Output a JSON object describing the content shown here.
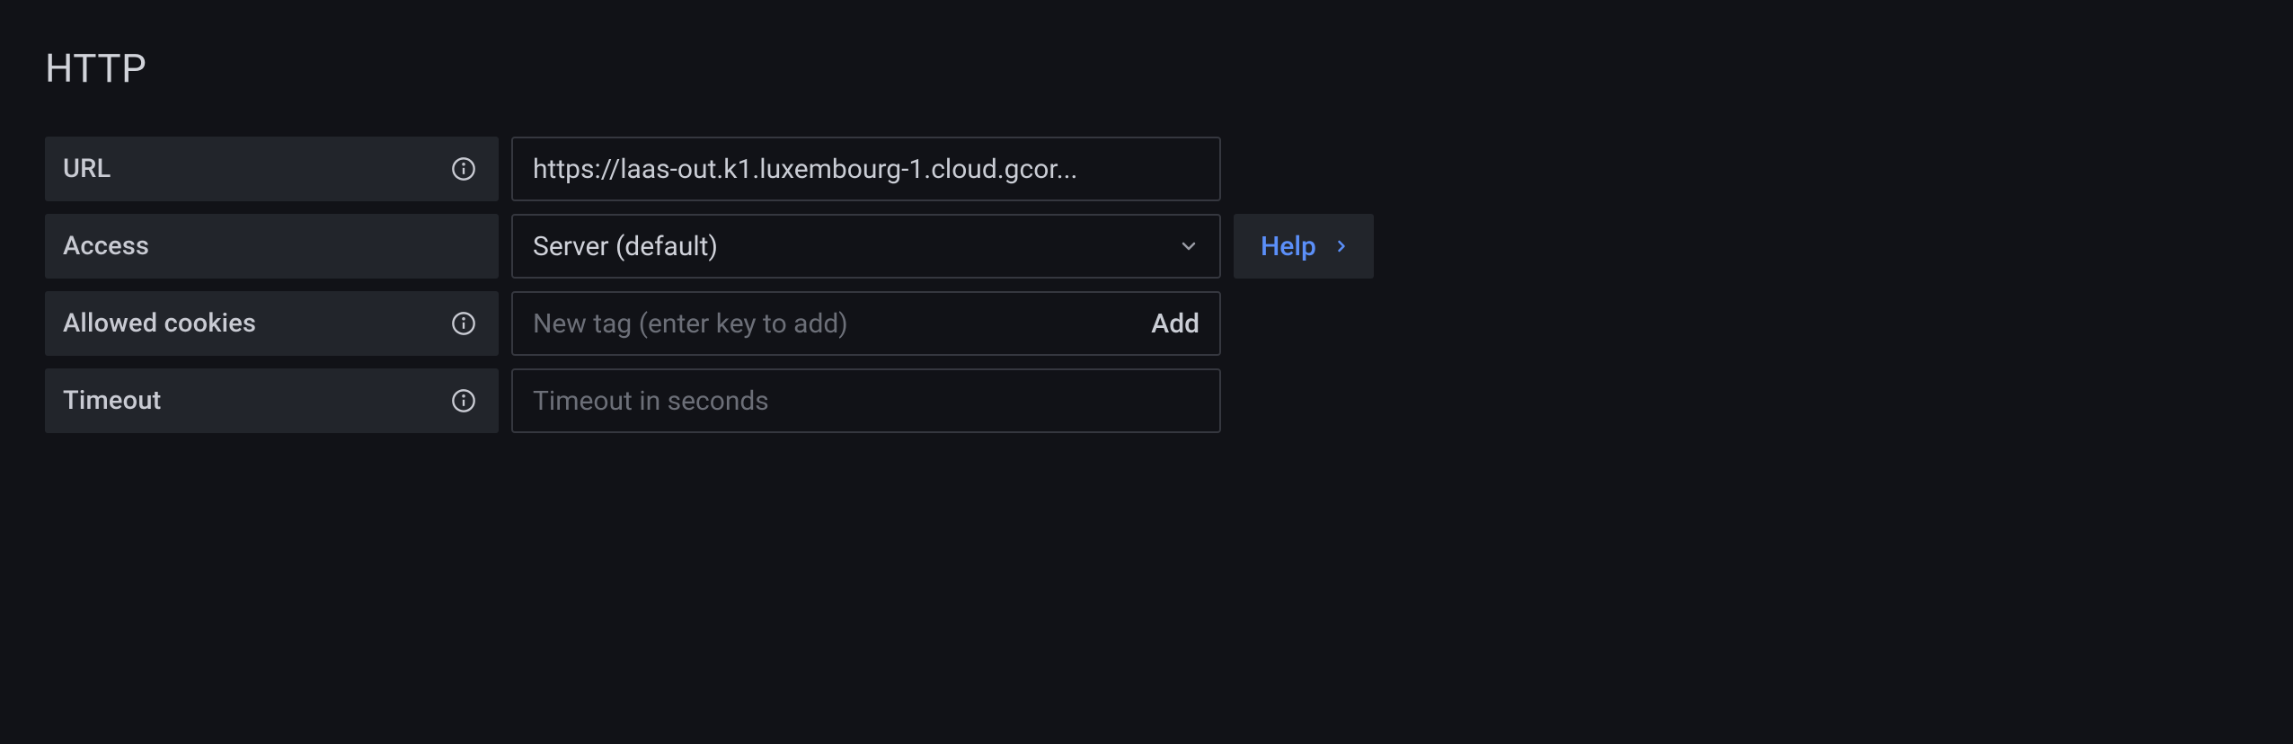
{
  "section": {
    "title": "HTTP"
  },
  "fields": {
    "url": {
      "label": "URL",
      "value": "https://laas-out.k1.luxembourg-1.cloud.gcor...",
      "has_info": true
    },
    "access": {
      "label": "Access",
      "value": "Server (default)",
      "has_info": false,
      "help_label": "Help"
    },
    "allowed_cookies": {
      "label": "Allowed cookies",
      "placeholder": "New tag (enter key to add)",
      "add_label": "Add",
      "has_info": true
    },
    "timeout": {
      "label": "Timeout",
      "placeholder": "Timeout in seconds",
      "has_info": true
    }
  },
  "icons": {
    "info": "info-icon",
    "chevron_down": "chevron-down-icon",
    "chevron_right": "chevron-right-icon"
  }
}
